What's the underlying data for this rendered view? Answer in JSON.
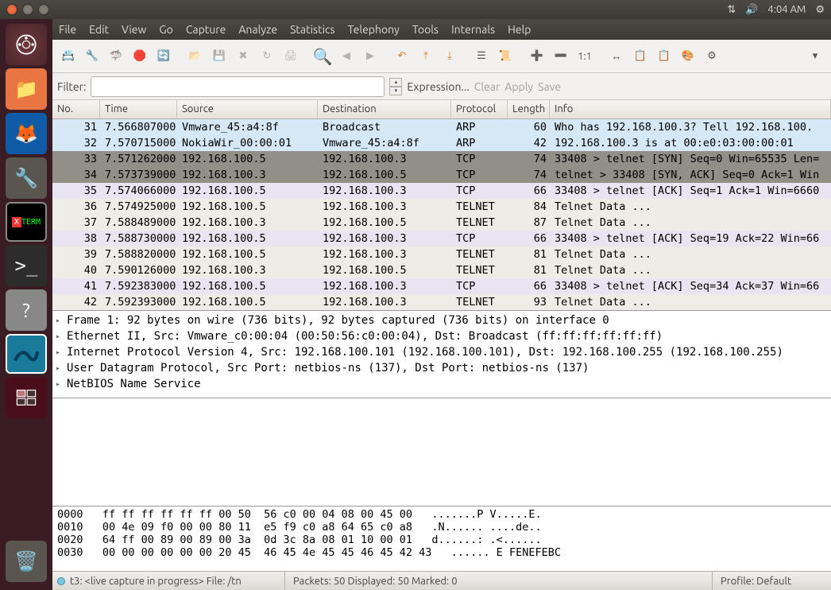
{
  "panel": {
    "time": "4:04 AM"
  },
  "menubar": [
    "File",
    "Edit",
    "View",
    "Go",
    "Capture",
    "Analyze",
    "Statistics",
    "Telephony",
    "Tools",
    "Internals",
    "Help"
  ],
  "filter": {
    "label": "Filter:",
    "value": "",
    "expression": "Expression...",
    "clear": "Clear",
    "apply": "Apply",
    "save": "Save"
  },
  "columns": {
    "no": "No.",
    "time": "Time",
    "source": "Source",
    "destination": "Destination",
    "protocol": "Protocol",
    "length": "Length",
    "info": "Info"
  },
  "packets": [
    {
      "no": 31,
      "time": "7.566807000",
      "src": "Vmware_45:a4:8f",
      "dst": "Broadcast",
      "proto": "ARP",
      "len": 60,
      "info": "Who has 192.168.100.3?  Tell 192.168.100.",
      "cls": "r-arp"
    },
    {
      "no": 32,
      "time": "7.570715000",
      "src": "NokiaWir_00:00:01",
      "dst": "Vmware_45:a4:8f",
      "proto": "ARP",
      "len": 42,
      "info": "192.168.100.3 is at 00:e0:03:00:00:01",
      "cls": "r-arp"
    },
    {
      "no": 33,
      "time": "7.571262000",
      "src": "192.168.100.5",
      "dst": "192.168.100.3",
      "proto": "TCP",
      "len": 74,
      "info": "33408 > telnet [SYN] Seq=0 Win=65535 Len=",
      "cls": "r-sel"
    },
    {
      "no": 34,
      "time": "7.573739000",
      "src": "192.168.100.3",
      "dst": "192.168.100.5",
      "proto": "TCP",
      "len": 74,
      "info": "telnet > 33408 [SYN, ACK] Seq=0 Ack=1 Win",
      "cls": "r-sel"
    },
    {
      "no": 35,
      "time": "7.574066000",
      "src": "192.168.100.5",
      "dst": "192.168.100.3",
      "proto": "TCP",
      "len": 66,
      "info": "33408 > telnet [ACK] Seq=1 Ack=1 Win=6660",
      "cls": "r-tcp"
    },
    {
      "no": 36,
      "time": "7.574925000",
      "src": "192.168.100.5",
      "dst": "192.168.100.3",
      "proto": "TELNET",
      "len": 84,
      "info": "Telnet Data ...",
      "cls": "r-tel"
    },
    {
      "no": 37,
      "time": "7.588489000",
      "src": "192.168.100.3",
      "dst": "192.168.100.5",
      "proto": "TELNET",
      "len": 87,
      "info": "Telnet Data ...",
      "cls": "r-tel"
    },
    {
      "no": 38,
      "time": "7.588730000",
      "src": "192.168.100.5",
      "dst": "192.168.100.3",
      "proto": "TCP",
      "len": 66,
      "info": "33408 > telnet [ACK] Seq=19 Ack=22 Win=66",
      "cls": "r-tcp"
    },
    {
      "no": 39,
      "time": "7.588820000",
      "src": "192.168.100.5",
      "dst": "192.168.100.3",
      "proto": "TELNET",
      "len": 81,
      "info": "Telnet Data ...",
      "cls": "r-tel"
    },
    {
      "no": 40,
      "time": "7.590126000",
      "src": "192.168.100.3",
      "dst": "192.168.100.5",
      "proto": "TELNET",
      "len": 81,
      "info": "Telnet Data ...",
      "cls": "r-tel"
    },
    {
      "no": 41,
      "time": "7.592383000",
      "src": "192.168.100.5",
      "dst": "192.168.100.3",
      "proto": "TCP",
      "len": 66,
      "info": "33408 > telnet [ACK] Seq=34 Ack=37 Win=66",
      "cls": "r-tcp"
    },
    {
      "no": 42,
      "time": "7.592393000",
      "src": "192.168.100.5",
      "dst": "192.168.100.3",
      "proto": "TELNET",
      "len": 93,
      "info": "Telnet Data ...",
      "cls": "r-tel"
    }
  ],
  "details": [
    "Frame 1: 92 bytes on wire (736 bits), 92 bytes captured (736 bits) on interface 0",
    "Ethernet II, Src: Vmware_c0:00:04 (00:50:56:c0:00:04), Dst: Broadcast (ff:ff:ff:ff:ff:ff)",
    "Internet Protocol Version 4, Src: 192.168.100.101 (192.168.100.101), Dst: 192.168.100.255 (192.168.100.255)",
    "User Datagram Protocol, Src Port: netbios-ns (137), Dst Port: netbios-ns (137)",
    "NetBIOS Name Service"
  ],
  "hex": [
    "0000   ff ff ff ff ff ff 00 50  56 c0 00 04 08 00 45 00   .......P V.....E.",
    "0010   00 4e 09 f0 00 00 80 11  e5 f9 c0 a8 64 65 c0 a8   .N...... ....de..",
    "0020   64 ff 00 89 00 89 00 3a  0d 3c 8a 08 01 10 00 01   d......: .<......",
    "0030   00 00 00 00 00 00 20 45  46 45 4e 45 45 46 45 42 43   ...... E FENEFEBC"
  ],
  "status": {
    "capture": "t3: <live capture in progress> File: /tn",
    "packets": "Packets: 50 Displayed: 50 Marked: 0",
    "profile": "Profile: Default"
  }
}
